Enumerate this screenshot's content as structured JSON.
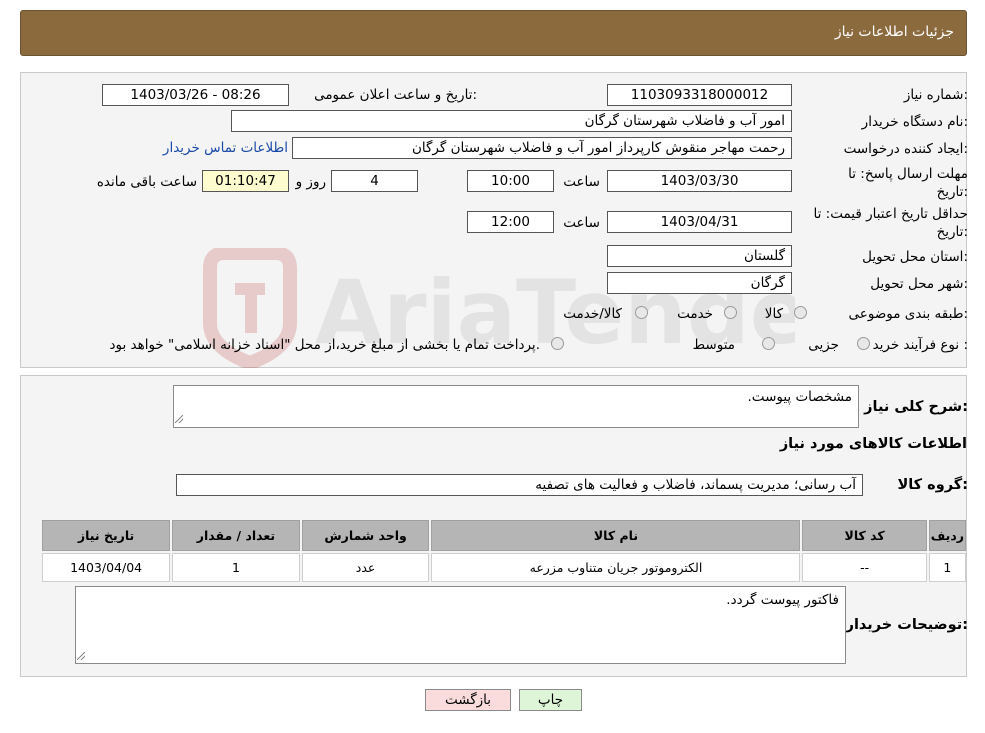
{
  "header": {
    "title": "جزئیات اطلاعات نیاز"
  },
  "form": {
    "need_number_label": "شماره نیاز:",
    "need_number": "1103093318000012",
    "announce_label": "تاریخ و ساعت اعلان عمومی:",
    "announce_value": "1403/03/26 - 08:26",
    "buyer_org_label": "نام دستگاه خریدار:",
    "buyer_org": "امور آب و فاضلاب شهرستان گرگان",
    "creator_label": "ایجاد کننده درخواست:",
    "creator": "رحمت مهاجر منقوش کارپرداز امور آب و فاضلاب شهرستان گرگان",
    "contact_link": "اطلاعات تماس خریدار",
    "deadline_label_1": "مهلت ارسال پاسخ: تا",
    "deadline_label_2": "تاریخ:",
    "deadline_date": "1403/03/30",
    "time_label": "ساعت",
    "deadline_time": "10:00",
    "days": "4",
    "days_label": "روز و",
    "remaining": "01:10:47",
    "remaining_label": "ساعت باقی مانده",
    "validity_label_1": "حداقل تاریخ اعتبار قیمت: تا",
    "validity_label_2": "تاریخ:",
    "validity_date": "1403/04/31",
    "validity_time_label": "ساعت",
    "validity_time": "12:00",
    "province_label": "استان محل تحویل:",
    "province": "گلستان",
    "city_label": "شهر محل تحویل:",
    "city": "گرگان",
    "category_label": "طبقه بندی موضوعی:",
    "category_options": [
      "کالا",
      "خدمت",
      "کالا/خدمت"
    ],
    "process_label": "نوع فرآیند خرید :",
    "process_options": [
      "جزیی",
      "متوسط"
    ],
    "process_note": "پرداخت تمام یا بخشی از مبلغ خرید،از محل \"اسناد خزانه اسلامی\" خواهد بود."
  },
  "details": {
    "summary_label": "شرح کلی نیاز:",
    "summary": "مشخصات پیوست.",
    "goods_title": "اطلاعات کالاهای مورد نیاز",
    "group_label": "گروه کالا:",
    "group": "آب رسانی؛ مدیریت پسماند، فاضلاب و فعالیت های تصفیه",
    "table": {
      "headers": [
        "ردیف",
        "کد کالا",
        "نام کالا",
        "واحد شمارش",
        "تعداد / مقدار",
        "تاریخ نیاز"
      ],
      "rows": [
        [
          "1",
          "--",
          "الکتروموتور جریان متناوب مزرعه",
          "عدد",
          "1",
          "1403/04/04"
        ]
      ]
    },
    "buyer_notes_label": "توضیحات خریدار:",
    "buyer_notes": "فاکتور پیوست گردد."
  },
  "buttons": {
    "print": "چاپ",
    "back": "بازگشت"
  },
  "colors": {
    "header": "#8b6a3e",
    "print_button": "#dff5d8",
    "back_button": "#fadcdc"
  }
}
